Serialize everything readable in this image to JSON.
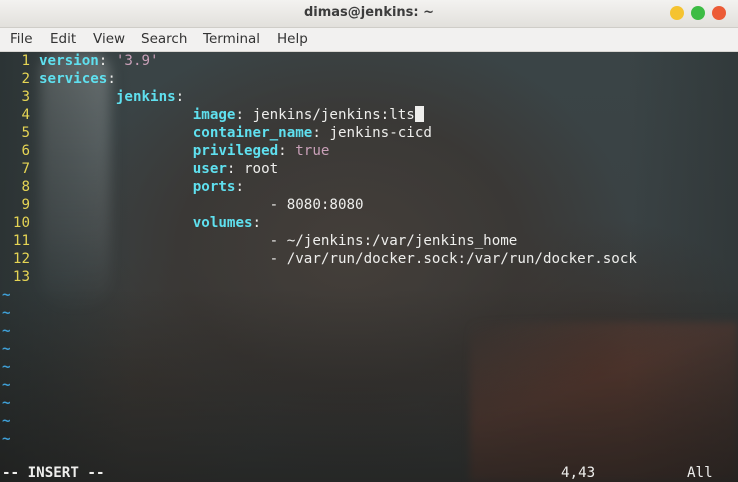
{
  "window": {
    "title": "dimas@jenkins: ~"
  },
  "menu": [
    "File",
    "Edit",
    "View",
    "Search",
    "Terminal",
    "Help"
  ],
  "editor": {
    "lines": [
      {
        "n": "1",
        "indent": "",
        "key": "version",
        "sep": ": ",
        "value": "'3.9'",
        "value_type": "str"
      },
      {
        "n": "2",
        "indent": "",
        "key": "services",
        "sep": ":",
        "value": "",
        "value_type": ""
      },
      {
        "n": "3",
        "indent": "         ",
        "key": "jenkins",
        "sep": ":",
        "value": "",
        "value_type": ""
      },
      {
        "n": "4",
        "indent": "                  ",
        "key": "image",
        "sep": ": ",
        "value": "jenkins/jenkins:lts",
        "value_type": "val",
        "cursor": true
      },
      {
        "n": "5",
        "indent": "                  ",
        "key": "container_name",
        "sep": ": ",
        "value": "jenkins-cicd",
        "value_type": "val"
      },
      {
        "n": "6",
        "indent": "                  ",
        "key": "privileged",
        "sep": ": ",
        "value": "true",
        "value_type": "bool"
      },
      {
        "n": "7",
        "indent": "                  ",
        "key": "user",
        "sep": ": ",
        "value": "root",
        "value_type": "val"
      },
      {
        "n": "8",
        "indent": "                  ",
        "key": "ports",
        "sep": ":",
        "value": "",
        "value_type": ""
      },
      {
        "n": "9",
        "indent": "                           ",
        "key": "",
        "sep": "- ",
        "value": "8080:8080",
        "value_type": "val"
      },
      {
        "n": "10",
        "indent": "                  ",
        "key": "volumes",
        "sep": ":",
        "value": "",
        "value_type": ""
      },
      {
        "n": "11",
        "indent": "                           ",
        "key": "",
        "sep": "- ",
        "value": "~/jenkins:/var/jenkins_home",
        "value_type": "val"
      },
      {
        "n": "12",
        "indent": "                           ",
        "key": "",
        "sep": "- ",
        "value": "/var/run/docker.sock:/var/run/docker.sock",
        "value_type": "val"
      },
      {
        "n": "13",
        "indent": "",
        "key": "",
        "sep": "",
        "value": "",
        "value_type": ""
      }
    ],
    "empty_marker": "~",
    "empty_line_count": 9
  },
  "status": {
    "mode": "-- INSERT --",
    "position": "4,43",
    "scroll": "All"
  },
  "colors": {
    "line_number": "#e5d454",
    "key": "#5fe0ef",
    "string": "#c9a0b8",
    "text": "#eeeeec",
    "tilde": "#3f9fd6",
    "btn_close": "#ec5b36",
    "btn_min": "#f5c330",
    "btn_max": "#3cbc44"
  }
}
